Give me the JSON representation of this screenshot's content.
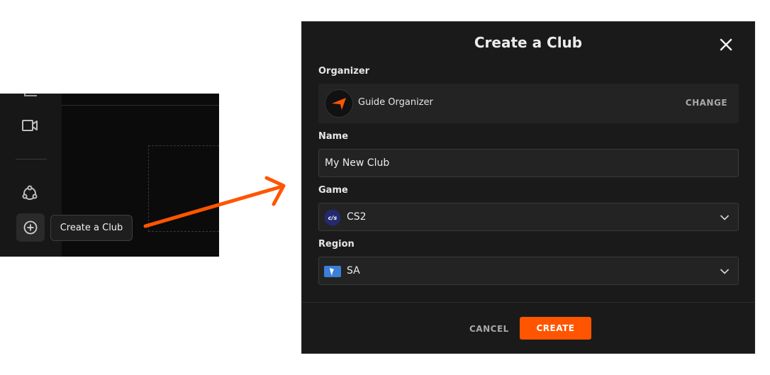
{
  "tooltip": {
    "label": "Create a Club"
  },
  "sidebar_icons": [
    "partial-icon",
    "video-icon",
    "clubs-icon",
    "add-circle-icon"
  ],
  "modal": {
    "title": "Create a Club",
    "organizer": {
      "label": "Organizer",
      "name": "Guide Organizer",
      "change_label": "CHANGE"
    },
    "name": {
      "label": "Name",
      "value": "My New Club"
    },
    "game": {
      "label": "Game",
      "value": "CS2",
      "icon": "cs2-icon",
      "icon_text": "c/s"
    },
    "region": {
      "label": "Region",
      "value": "SA",
      "icon": "south-america-flag-icon"
    },
    "buttons": {
      "cancel": "CANCEL",
      "create": "CREATE"
    }
  },
  "colors": {
    "accent": "#ff5500",
    "modal_bg": "#1a1a1a",
    "field_bg": "#232323",
    "region_icon": "#3b7fd6"
  }
}
